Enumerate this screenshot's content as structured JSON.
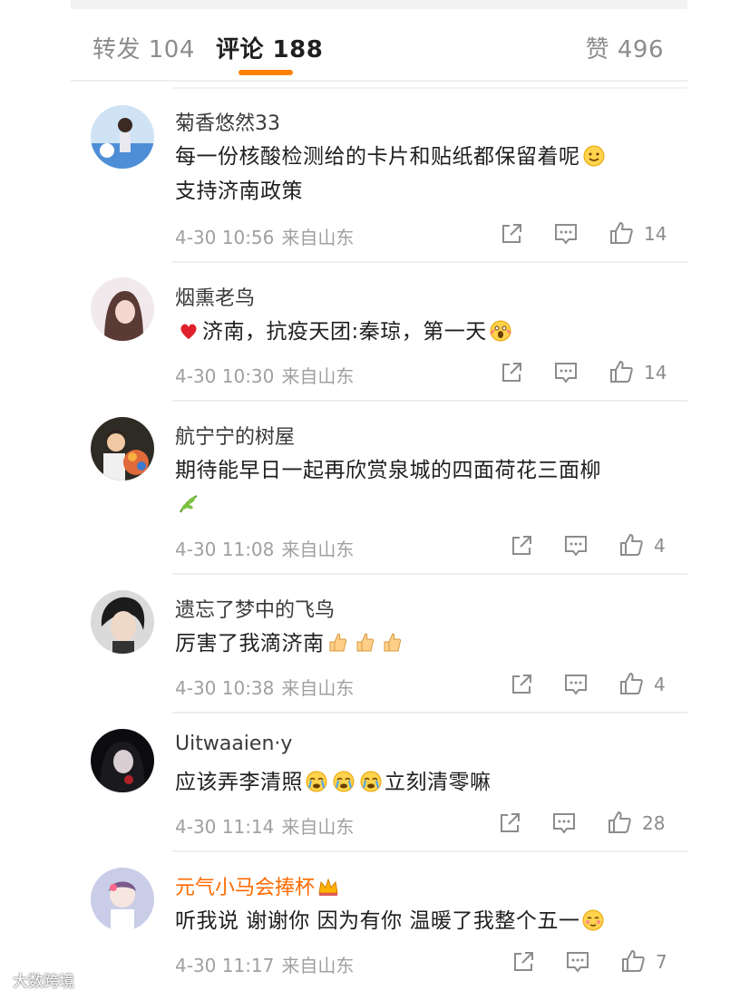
{
  "tabs": {
    "repost": "转发 104",
    "comment": "评论 188",
    "like": "赞 496"
  },
  "colors": {
    "accent": "#ff8200",
    "vip_name": "#ff6a00",
    "meta_text": "#a0a0a0"
  },
  "comments": [
    {
      "name": "菊香悠然33",
      "text": "每一份核酸检测给的卡片和贴纸都保留着呢",
      "text2": "支持济南政策",
      "time": "4-30 10:56",
      "source": "来自山东",
      "likes": "14"
    },
    {
      "name": "烟熏老鸟",
      "text": "济南，抗疫天团:秦琼，第一天",
      "time": "4-30 10:30",
      "source": "来自山东",
      "likes": "14"
    },
    {
      "name": "航宁宁的树屋",
      "text": "期待能早日一起再欣赏泉城的四面荷花三面柳",
      "time": "4-30 11:08",
      "source": "来自山东",
      "likes": "4"
    },
    {
      "name": "遗忘了梦中的飞鸟",
      "text": "厉害了我滴济南",
      "time": "4-30 10:38",
      "source": "来自山东",
      "likes": "4"
    },
    {
      "name": "Uitwaaien·y",
      "text_a": "应该弄李清照",
      "text_b": "立刻清零嘛",
      "time": "4-30 11:14",
      "source": "来自山东",
      "likes": "28"
    },
    {
      "name": "元气小马会捧杯",
      "text": "听我说 谢谢你 因为有你 温暖了我整个五一",
      "time": "4-30 11:17",
      "source": "来自山东",
      "likes": "7"
    }
  ],
  "icons": {
    "share": "share-icon",
    "comment": "comment-icon",
    "like": "thumbs-up-icon"
  },
  "watermark": "大数跨境"
}
